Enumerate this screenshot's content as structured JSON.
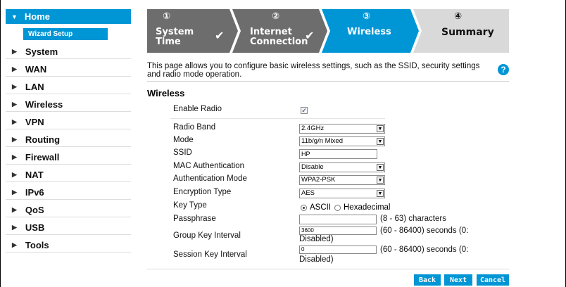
{
  "sidebar": {
    "home": "Home",
    "wizard": "Wizard Setup",
    "items": [
      "System",
      "WAN",
      "LAN",
      "Wireless",
      "VPN",
      "Routing",
      "Firewall",
      "NAT",
      "IPv6",
      "QoS",
      "USB",
      "Tools"
    ]
  },
  "steps": [
    {
      "num": "①",
      "label1": "System",
      "label2": "Time",
      "state": "done"
    },
    {
      "num": "②",
      "label1": "Internet",
      "label2": "Connection",
      "state": "done"
    },
    {
      "num": "③",
      "label1": "Wireless",
      "label2": "",
      "state": "current"
    },
    {
      "num": "④",
      "label1": "Summary",
      "label2": "",
      "state": "todo"
    }
  ],
  "colors": {
    "accent": "#0096d6",
    "done": "#6d6d6d",
    "todo": "#d9d9d9"
  },
  "description": "This page allows you to configure basic wireless settings, such as the SSID, security settings and radio mode operation.",
  "help": "?",
  "section_title": "Wireless",
  "form": {
    "enable_radio": {
      "label": "Enable Radio",
      "checked": true
    },
    "radio_band": {
      "label": "Radio Band",
      "value": "2.4GHz"
    },
    "mode": {
      "label": "Mode",
      "value": "11b/g/n Mixed"
    },
    "ssid": {
      "label": "SSID",
      "value": "HP"
    },
    "mac_auth": {
      "label": "MAC Authentication",
      "value": "Disable"
    },
    "auth_mode": {
      "label": "Authentication Mode",
      "value": "WPA2-PSK"
    },
    "encryption": {
      "label": "Encryption Type",
      "value": "AES"
    },
    "key_type": {
      "label": "Key Type",
      "option1": "ASCII",
      "option2": "Hexadecimal",
      "selected": "ASCII"
    },
    "passphrase": {
      "label": "Passphrase",
      "value": "",
      "hint": "(8 - 63) characters"
    },
    "group_key": {
      "label": "Group Key Interval",
      "value": "3600",
      "hint": "(60 - 86400) seconds  (0:",
      "hint2": "Disabled)"
    },
    "session_key": {
      "label": "Session Key Interval",
      "value": "0",
      "hint": "(60 - 86400) seconds  (0:",
      "hint2": "Disabled)"
    }
  },
  "buttons": {
    "back": "Back",
    "next": "Next",
    "cancel": "Cancel"
  }
}
